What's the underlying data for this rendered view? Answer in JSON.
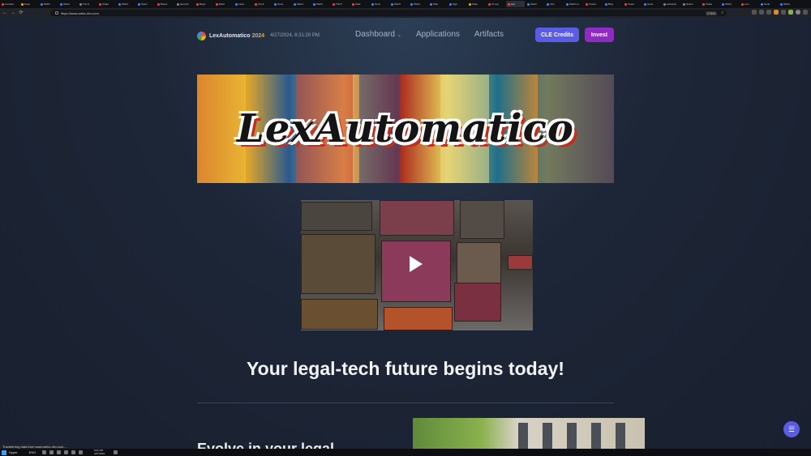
{
  "browser": {
    "tabs": [
      {
        "label": "LexAuto",
        "color": "#e94b3c"
      },
      {
        "label": "Keep",
        "color": "#f4b400"
      },
      {
        "label": "WebC",
        "color": "#4285f4"
      },
      {
        "label": "WebC",
        "color": "#4285f4"
      },
      {
        "label": "The E",
        "color": "#888888"
      },
      {
        "label": "Chapt",
        "color": "#e94b3c"
      },
      {
        "label": "WebC",
        "color": "#4285f4"
      },
      {
        "label": "Searc",
        "color": "#4285f4"
      },
      {
        "label": "Bayes",
        "color": "#e94b3c"
      },
      {
        "label": "quora.R",
        "color": "#888888"
      },
      {
        "label": "Begin",
        "color": "#e94b3c"
      },
      {
        "label": "Build",
        "color": "#e94b3c"
      },
      {
        "label": "Laws",
        "color": "#4285f4"
      },
      {
        "label": "(3) Hi",
        "color": "#e94b3c"
      },
      {
        "label": "Gene",
        "color": "#4285f4"
      },
      {
        "label": "WebC",
        "color": "#4285f4"
      },
      {
        "label": "WebC",
        "color": "#4285f4"
      },
      {
        "label": "TheTl",
        "color": "#e94b3c"
      },
      {
        "label": "Zwid",
        "color": "#e94b3c"
      },
      {
        "label": "Struc",
        "color": "#4285f4"
      },
      {
        "label": "WebC",
        "color": "#4285f4"
      },
      {
        "label": "WebC",
        "color": "#4285f4"
      },
      {
        "label": "Shar",
        "color": "#4285f4"
      },
      {
        "label": "Sign",
        "color": "#4285f4"
      },
      {
        "label": "Scap",
        "color": "#f4b400"
      },
      {
        "label": "AI Leg",
        "color": "#e94b3c"
      },
      {
        "label": "Lex",
        "color": "#e94b3c",
        "active": true
      },
      {
        "label": "WebC",
        "color": "#4285f4"
      },
      {
        "label": "Intro",
        "color": "#4285f4"
      },
      {
        "label": "WebC.ai",
        "color": "#4285f4"
      },
      {
        "label": "Tweed",
        "color": "#e94b3c"
      },
      {
        "label": "Blog",
        "color": "#4285f4"
      },
      {
        "label": "Tweet",
        "color": "#e94b3c"
      },
      {
        "label": "Gene",
        "color": "#4285f4"
      },
      {
        "label": "authentic",
        "color": "#888888"
      },
      {
        "label": "Notion",
        "color": "#888888"
      },
      {
        "label": "Tweet",
        "color": "#e94b3c"
      },
      {
        "label": "WebC",
        "color": "#4285f4"
      },
      {
        "label": "Lexi",
        "color": "#e94b3c"
      },
      {
        "label": "Node",
        "color": "#4285f4"
      },
      {
        "label": "WebC",
        "color": "#4285f4"
      }
    ],
    "nav": {
      "back": "←",
      "forward": "→",
      "reload": "⟳"
    },
    "url": "https://www.webc.dev.com",
    "zoom": "175%",
    "status_text": "Transferring data from www.webc.dev.com..."
  },
  "header": {
    "brand": "LexAutomatico",
    "year": "2024",
    "datetime": "4/27/2024, 8:31:20 PM",
    "menu": [
      {
        "label": "Dashboard",
        "has_dropdown": true
      },
      {
        "label": "Applications"
      },
      {
        "label": "Artifacts"
      }
    ],
    "cle_button": "CLE Credits",
    "invest_button": "Invest"
  },
  "banner": {
    "title": "LexAutomatico"
  },
  "video": {
    "play_icon": "play-icon"
  },
  "main": {
    "headline": "Your legal-tech future begins today!",
    "partial_heading": "Evolve in your legal"
  },
  "fab": {
    "icon": "settings-toggle-icon"
  },
  "taskbar": {
    "search_label": "Hyper",
    "lang": "ENG",
    "time": "8:31 PM",
    "date": "4/27/2024"
  },
  "colors": {
    "accent": "#5b5ce6",
    "invest": "#8f2bc2",
    "brand_year": "#f5a623"
  }
}
